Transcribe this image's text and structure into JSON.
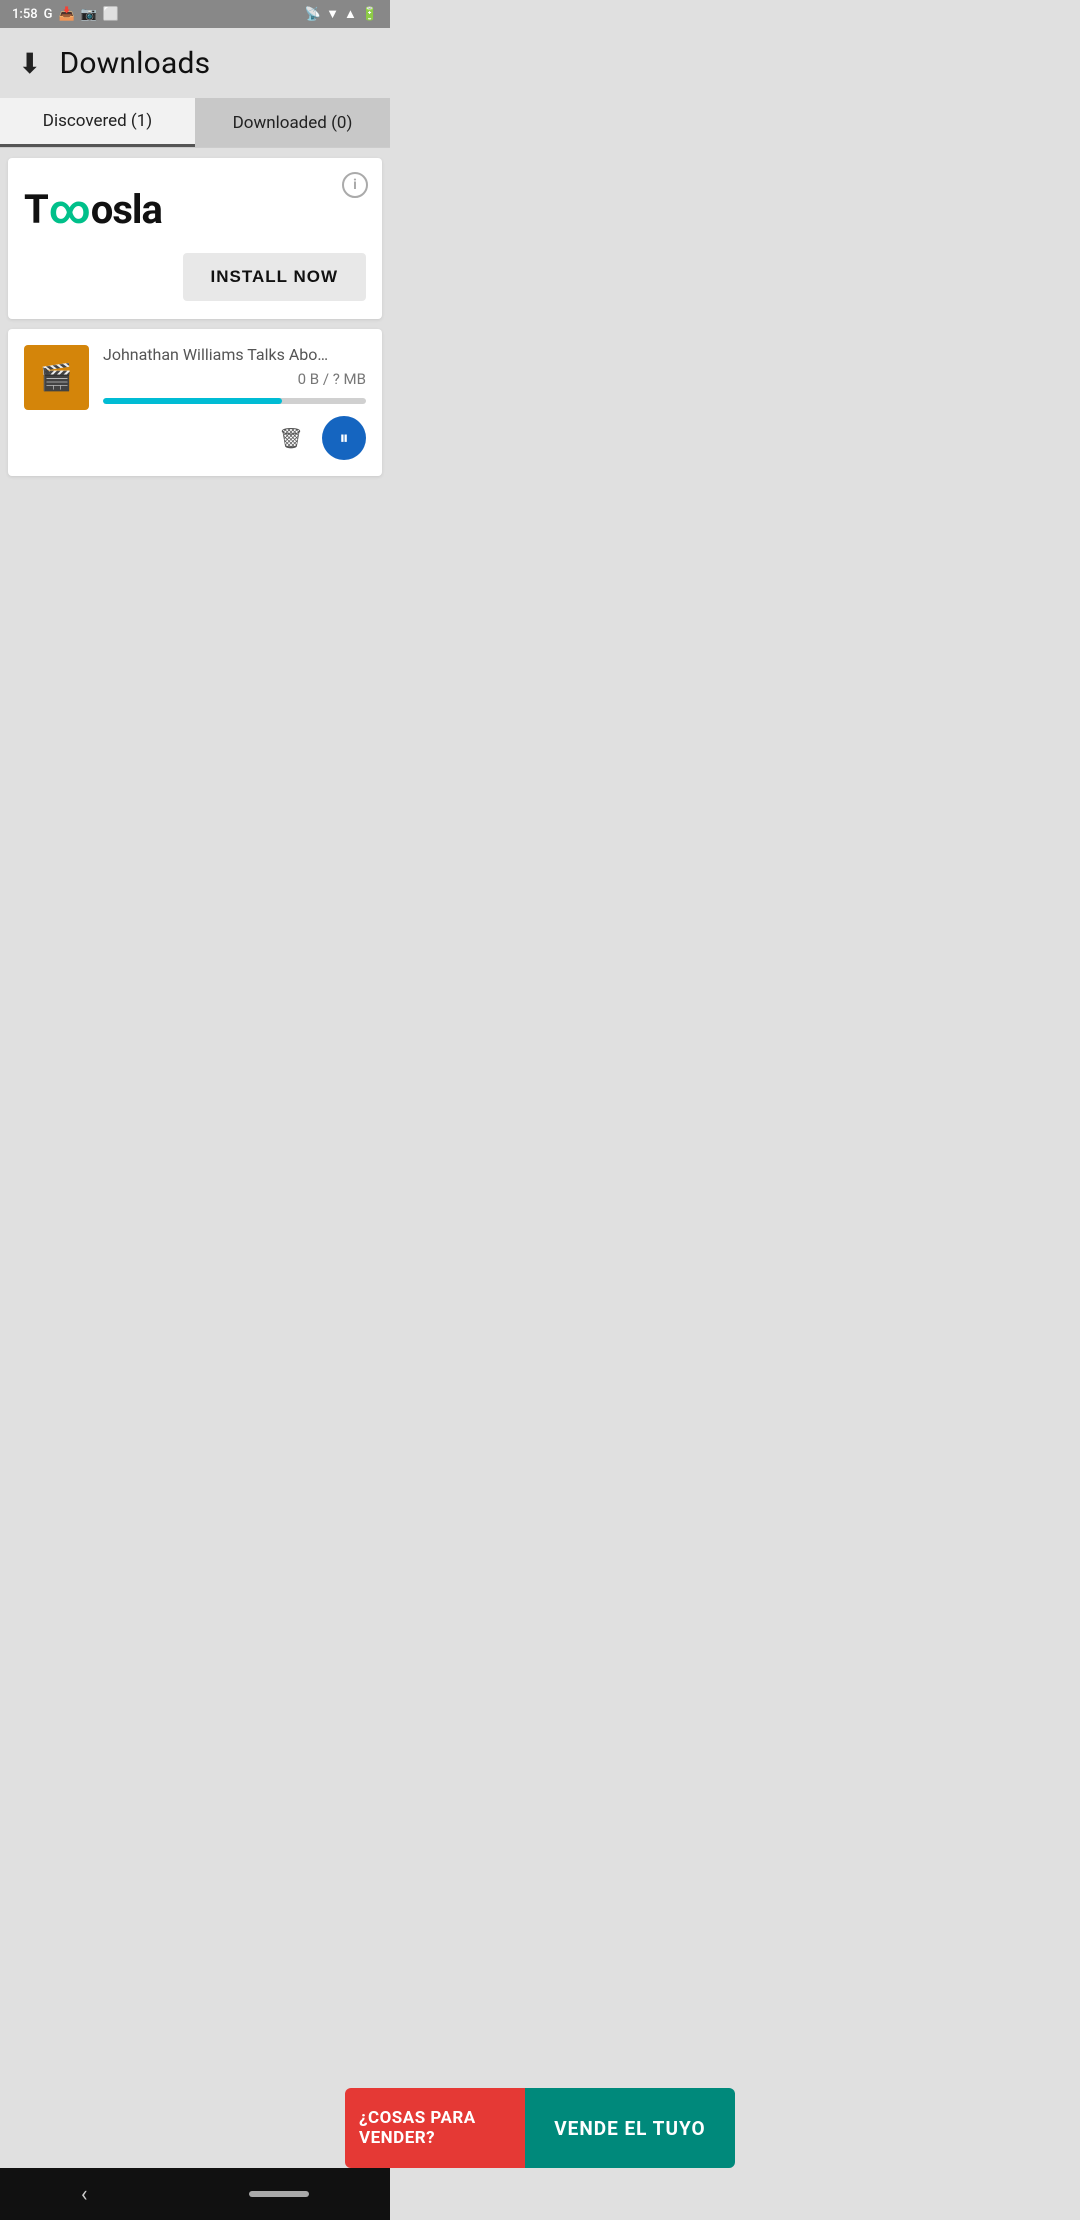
{
  "statusBar": {
    "time": "1:58",
    "icons": [
      "G",
      "📥",
      "📷",
      "⬜"
    ]
  },
  "header": {
    "title": "Downloads",
    "downloadIcon": "⬇"
  },
  "tabs": [
    {
      "label": "Discovered (1)",
      "active": true
    },
    {
      "label": "Downloaded (0)",
      "active": false
    }
  ],
  "adCard": {
    "brandName": "Toosla",
    "installLabel": "INSTALL NOW",
    "infoIcon": "i"
  },
  "downloadItem": {
    "title": "Johnathan Williams Talks About Playing…",
    "size": "0 B / ? MB",
    "progressPercent": 68
  },
  "adBanner": {
    "leftText": "¿COSAS PARA VENDER?",
    "rightText": "VENDE EL TUYO"
  }
}
